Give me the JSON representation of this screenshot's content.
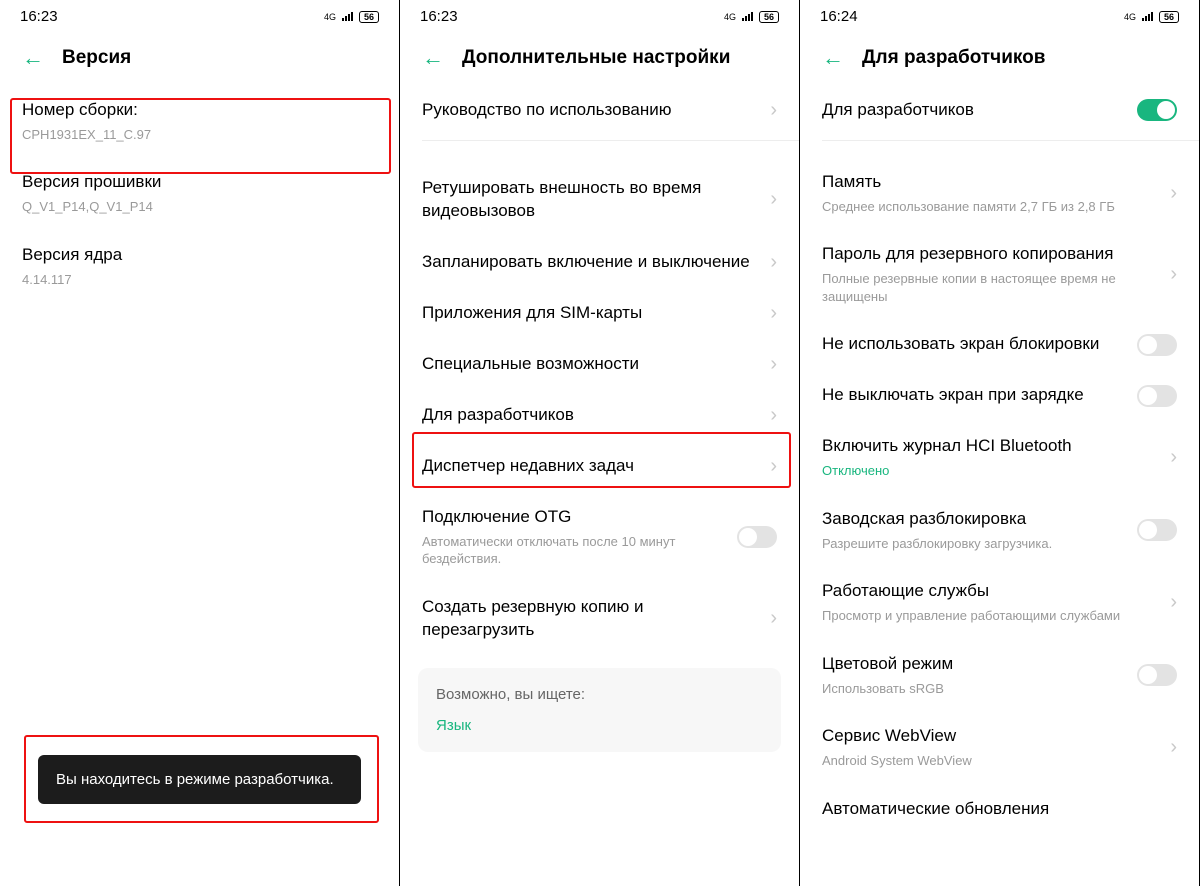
{
  "screen1": {
    "status": {
      "time": "16:23",
      "net": "4G",
      "battery": "56"
    },
    "header": {
      "title": "Версия"
    },
    "build": {
      "label": "Номер сборки:",
      "value": "CPH1931EX_11_C.97"
    },
    "firmware": {
      "label": "Версия прошивки",
      "value": "Q_V1_P14,Q_V1_P14"
    },
    "kernel": {
      "label": "Версия ядра",
      "value": "4.14.117"
    },
    "toast": "Вы находитесь в режиме разработчика."
  },
  "screen2": {
    "status": {
      "time": "16:23",
      "net": "4G",
      "battery": "56"
    },
    "header": {
      "title": "Дополнительные настройки"
    },
    "items": {
      "guide": "Руководство по использованию",
      "retouch": "Ретушировать внешность во время видеовызовов",
      "schedule": "Запланировать включение и выключение",
      "sim": "Приложения для SIM-карты",
      "accessibility": "Специальные возможности",
      "developer": "Для разработчиков",
      "recent": "Диспетчер недавних задач",
      "otg": {
        "title": "Подключение OTG",
        "sub": "Автоматически отключать после 10 минут бездействия."
      },
      "backup": "Создать резервную копию и перезагрузить"
    },
    "suggest": {
      "title": "Возможно, вы ищете:",
      "link": "Язык"
    }
  },
  "screen3": {
    "status": {
      "time": "16:24",
      "net": "4G",
      "battery": "56"
    },
    "header": {
      "title": "Для разработчиков"
    },
    "items": {
      "toggle_main": "Для разработчиков",
      "memory": {
        "title": "Память",
        "sub": "Среднее использование памяти 2,7 ГБ из 2,8 ГБ"
      },
      "backup_pw": {
        "title": "Пароль для резервного копирования",
        "sub": "Полные резервные копии в настоящее время не защищены"
      },
      "no_lock": "Не использовать экран блокировки",
      "stay_awake": "Не выключать экран при зарядке",
      "hci": {
        "title": "Включить журнал HCI Bluetooth",
        "sub": "Отключено"
      },
      "oem": {
        "title": "Заводская разблокировка",
        "sub": "Разрешите разблокировку загрузчика."
      },
      "services": {
        "title": "Работающие службы",
        "sub": "Просмотр и управление работающими службами"
      },
      "color": {
        "title": "Цветовой режим",
        "sub": "Использовать sRGB"
      },
      "webview": {
        "title": "Сервис WebView",
        "sub": "Android System WebView"
      },
      "autoupdate": "Автоматические обновления"
    }
  }
}
